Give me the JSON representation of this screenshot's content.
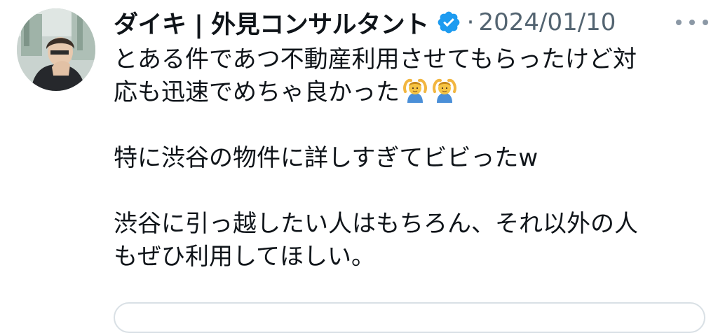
{
  "tweet": {
    "author_name": "ダイキ | 外見コンサルタント",
    "separator": "·",
    "date": "2024/01/10",
    "body": {
      "line1": "とある件であつ不動産利用させてもらったけど対",
      "line2": "応も迅速でめちゃ良かった",
      "line3": "特に渋谷の物件に詳しすぎてビビったw",
      "line4": "渋谷に引っ越したい人はもちろん、それ以外の人",
      "line5": "もぜひ利用してほしい。"
    },
    "emojis": [
      "person-gesturing-ok-emoji",
      "person-gesturing-ok-emoji"
    ]
  },
  "icons": {
    "verified": "verified-badge-icon",
    "more": "more-options-icon"
  },
  "colors": {
    "text_primary": "#0f1419",
    "text_secondary": "#536471",
    "verified_blue": "#1d9bf0",
    "divider": "#d9e0e5"
  }
}
